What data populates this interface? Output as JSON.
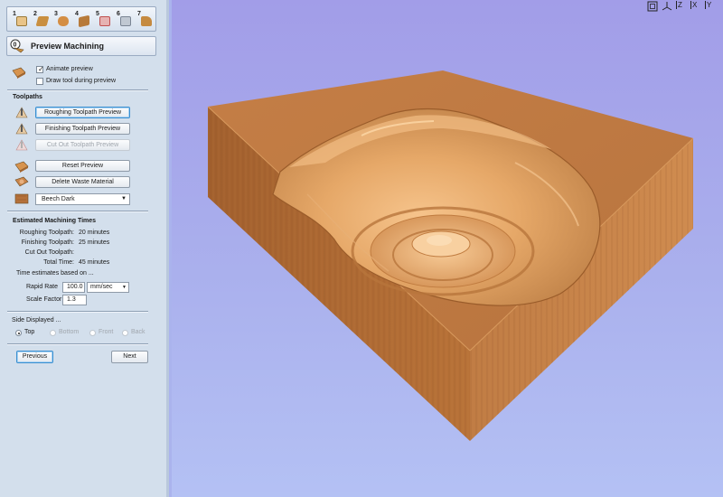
{
  "steps": {
    "numbers": [
      "1",
      "2",
      "3",
      "4",
      "5",
      "6",
      "7"
    ],
    "icons": [
      "toolpath-1-icon",
      "toolpath-2-icon",
      "toolpath-3-icon",
      "toolpath-4-icon",
      "toolpath-5-icon",
      "toolpath-6-icon",
      "toolpath-7-icon"
    ],
    "icon_colors": [
      "#d9a060",
      "#c98f40",
      "#d48e44",
      "#b77a3a",
      "#d46a6a",
      "#c0c8d2",
      "#c58a40"
    ],
    "current": "0"
  },
  "page_title": "Preview Machining",
  "animate": {
    "animate_preview_label": "Animate preview",
    "animate_preview_checked": true,
    "draw_tool_label": "Draw tool during preview",
    "draw_tool_checked": false
  },
  "toolpaths": {
    "heading": "Toolpaths",
    "roughing_label": "Roughing Toolpath Preview",
    "finishing_label": "Finishing Toolpath Preview",
    "cutout_label": "Cut Out Toolpath Preview",
    "reset_label": "Reset Preview",
    "delete_waste_label": "Delete Waste Material",
    "material_selected": "Beech Dark"
  },
  "times": {
    "heading": "Estimated Machining Times",
    "roughing_label": "Roughing Toolpath:",
    "roughing_value": "20 minutes",
    "finishing_label": "Finishing Toolpath:",
    "finishing_value": "25 minutes",
    "cutout_label": "Cut Out Toolpath:",
    "cutout_value": "",
    "total_label": "Total Time:",
    "total_value": "45 minutes",
    "based_on": "Time estimates based on ...",
    "rapid_rate_label": "Rapid Rate",
    "rapid_rate_value": "100.0",
    "rapid_rate_unit": "mm/sec",
    "scale_factor_label": "Scale Factor",
    "scale_factor_value": "1.3"
  },
  "side": {
    "heading": "Side Displayed ...",
    "options": [
      "Top",
      "Bottom",
      "Front",
      "Back"
    ],
    "selected": "Top"
  },
  "nav": {
    "previous_label": "Previous",
    "next_label": "Next"
  },
  "view_tools": {
    "zoom_fit_icon": "zoom-fit-icon",
    "iso_icon": "iso-view-icon",
    "z_label": "Z",
    "x_label": "X",
    "y_label": "Y"
  },
  "colors": {
    "panel_bg": "#d3dfec",
    "viewport_bg_top": "#a29de8",
    "viewport_bg_bottom": "#b4c1f4",
    "wood_top": "#c07a42",
    "wood_side_front": "#a8622e",
    "wood_side_right": "#c8844a",
    "carved_light": "#f0b878",
    "focus_border": "#3a8fd0"
  }
}
